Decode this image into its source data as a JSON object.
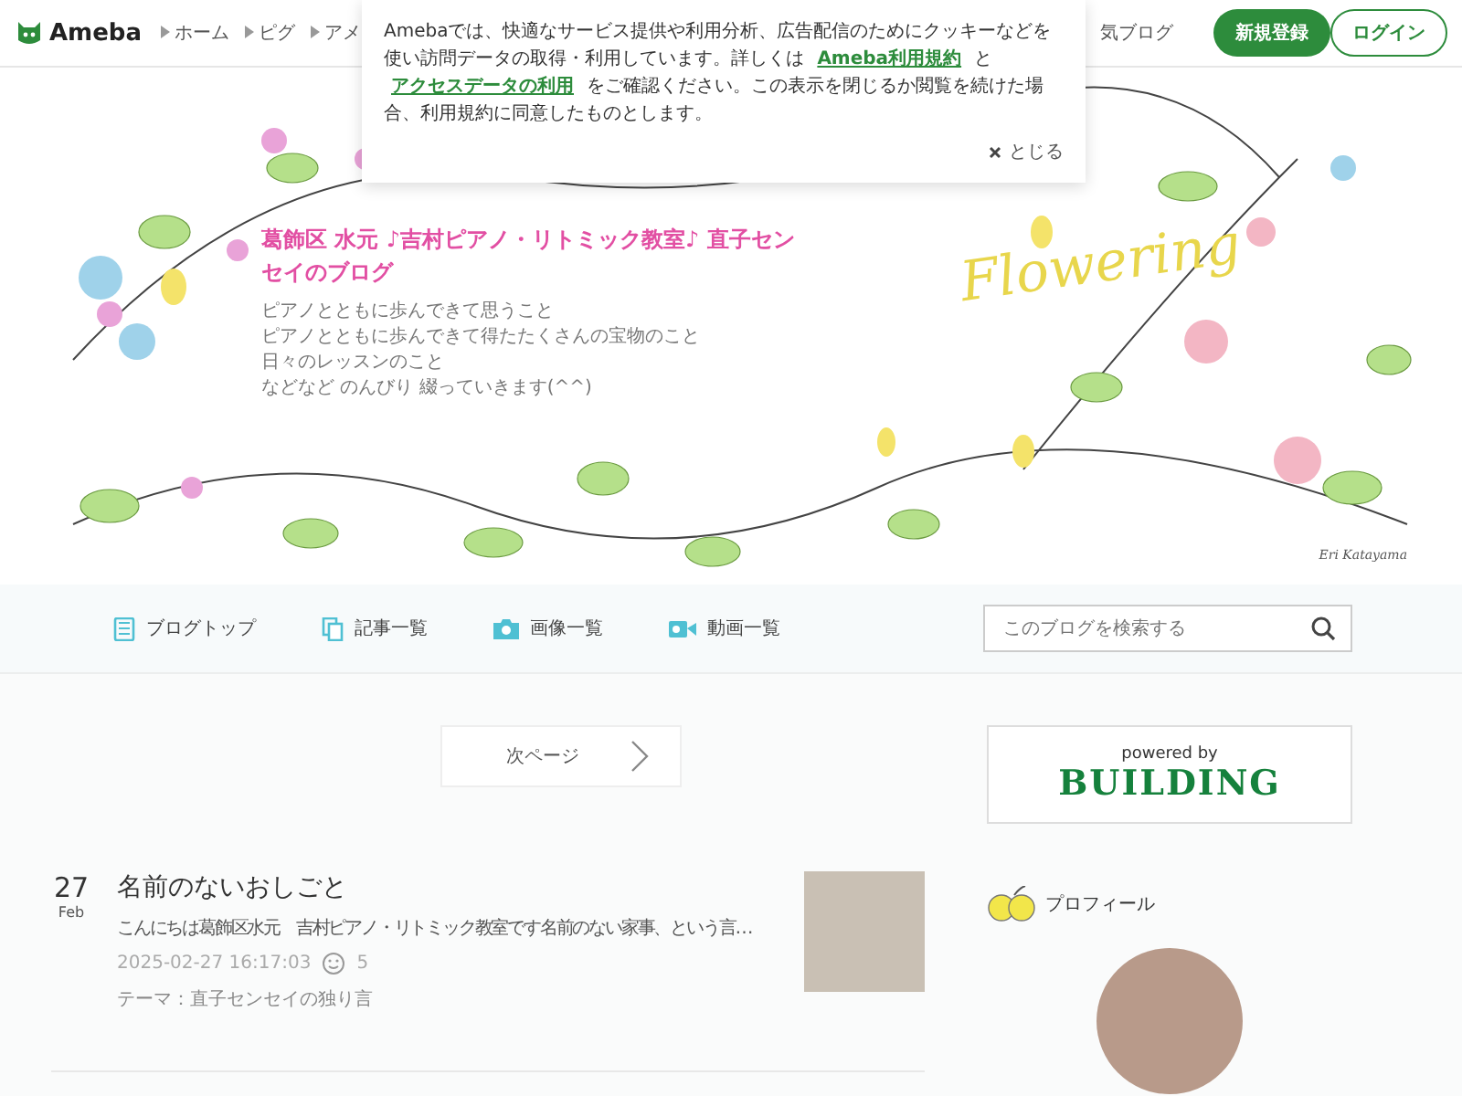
{
  "header": {
    "logo": "Ameba",
    "nav": [
      "ホーム",
      "ピグ",
      "アメ"
    ],
    "nav_right": "気ブログ",
    "signup": "新規登録",
    "login": "ログイン"
  },
  "cookie_notice": {
    "before": "Amebaでは、快適なサービス提供や利用分析、広告配信のためにクッキーなどを使い訪問データの取得・利用しています。詳しくは ",
    "link1": "Ameba利用規約",
    "middle": " と ",
    "link2": "アクセスデータの利用",
    "after": " をご確認ください。この表示を閉じるか閲覧を続けた場合、利用規約に同意したものとします。",
    "close": "とじる"
  },
  "banner": {
    "title": "葛飾区 水元 ♪吉村ピアノ・リトミック教室♪ 直子センセイのブログ",
    "description": [
      "ピアノとともに歩んできて思うこと",
      "ピアノとともに歩んできて得たたくさんの宝物のこと",
      "日々のレッスンのこと",
      "などなど のんびり 綴っていきます(^^)"
    ],
    "logo_text": "Flowering",
    "signature": "Eri Katayama"
  },
  "blog_nav": [
    {
      "label": "ブログトップ",
      "kind": "top"
    },
    {
      "label": "記事一覧",
      "kind": "list"
    },
    {
      "label": "画像一覧",
      "kind": "image"
    },
    {
      "label": "動画一覧",
      "kind": "video"
    }
  ],
  "search": {
    "placeholder": "このブログを検索する"
  },
  "pager": {
    "next": "次ページ"
  },
  "posts": [
    {
      "day": "27",
      "month": "Feb",
      "title": "名前のないおしごと",
      "excerpt": "こんにちは葛飾区水元　吉村ピアノ・リトミック教室です名前のない家事、という言…",
      "date": "2025-02-27 16:17:03",
      "likes": "5",
      "theme": "テーマ：直子センセイの独り言"
    }
  ],
  "sidebar": {
    "powered": "powered by",
    "brand": "BUILDING",
    "profile_heading": "プロフィール"
  }
}
